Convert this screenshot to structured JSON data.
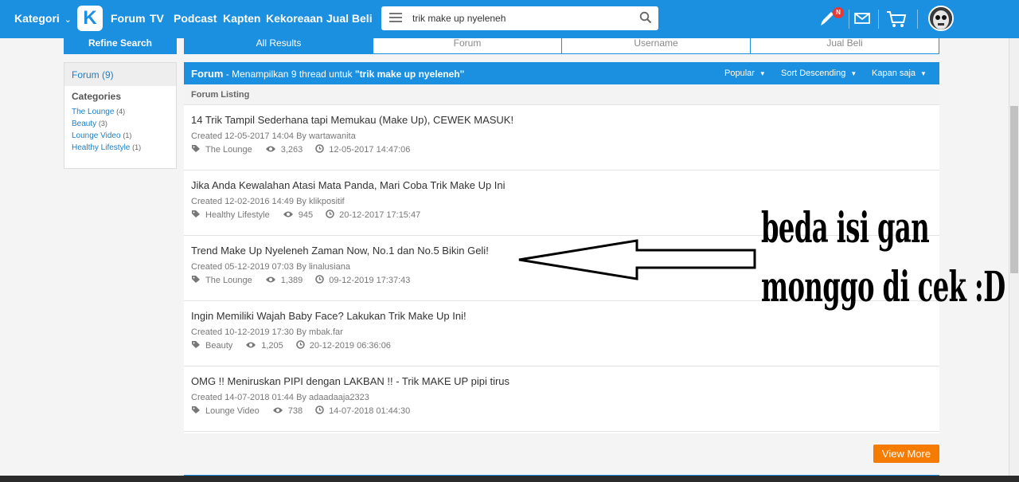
{
  "nav": {
    "kategori": "Kategori",
    "logo_letter": "K",
    "links": [
      "Forum",
      "TV",
      "Podcast",
      "Kapten",
      "Kekoreaan",
      "Jual Beli"
    ],
    "search_value": "trik make up nyeleneh",
    "notif_badge": "N"
  },
  "tabs": {
    "refine": "Refine Search",
    "items": [
      "All Results",
      "Forum",
      "Username",
      "Jual Beli"
    ],
    "active": "All Results"
  },
  "sidebar": {
    "forum_label": "Forum (9)",
    "categories_title": "Categories",
    "categories": [
      {
        "name": "The Lounge",
        "count": "(4)"
      },
      {
        "name": "Beauty",
        "count": "(3)"
      },
      {
        "name": "Lounge Video",
        "count": "(1)"
      },
      {
        "name": "Healthy Lifestyle",
        "count": "(1)"
      }
    ]
  },
  "main": {
    "title": "Forum",
    "subtitle_prefix": " - Menampilkan 9 thread untuk ",
    "subtitle_query": "\"trik make up nyeleneh\"",
    "options": [
      "Popular",
      "Sort Descending",
      "Kapan saja"
    ],
    "listing_label": "Forum Listing",
    "threads": [
      {
        "title": "14 Trik Tampil Sederhana tapi Memukau (Make Up), CEWEK MASUK!",
        "created": "Created 12-05-2017 14:04 By wartawanita",
        "category": "The Lounge",
        "views": "3,263",
        "last": "12-05-2017 14:47:06"
      },
      {
        "title": "Jika Anda Kewalahan Atasi Mata Panda, Mari Coba Trik Make Up Ini",
        "created": "Created 12-02-2016 14:49 By klikpositif",
        "category": "Healthy Lifestyle",
        "views": "945",
        "last": "20-12-2017 17:15:47"
      },
      {
        "title": "Trend Make Up Nyeleneh Zaman Now, No.1 dan No.5 Bikin Geli!",
        "created": "Created 05-12-2019 07:03 By linalusiana",
        "category": "The Lounge",
        "views": "1,389",
        "last": "09-12-2019 17:37:43"
      },
      {
        "title": "Ingin Memiliki Wajah Baby Face? Lakukan Trik Make Up Ini!",
        "created": "Created 10-12-2019 17:30 By mbak.far",
        "category": "Beauty",
        "views": "1,205",
        "last": "20-12-2019 06:36:06"
      },
      {
        "title": "OMG !! Meniruskan PIPI dengan LAKBAN !! - Trik MAKE UP pipi tirus",
        "created": "Created 14-07-2018 01:44 By adaadaaja2323",
        "category": "Lounge Video",
        "views": "738",
        "last": "14-07-2018 01:44:30"
      }
    ],
    "view_more": "View More"
  },
  "annotation": {
    "line1": "beda isi gan",
    "line2": "monggo di cek :D"
  },
  "colors": {
    "primary": "#1b8fe0",
    "accent": "#f57c00"
  }
}
